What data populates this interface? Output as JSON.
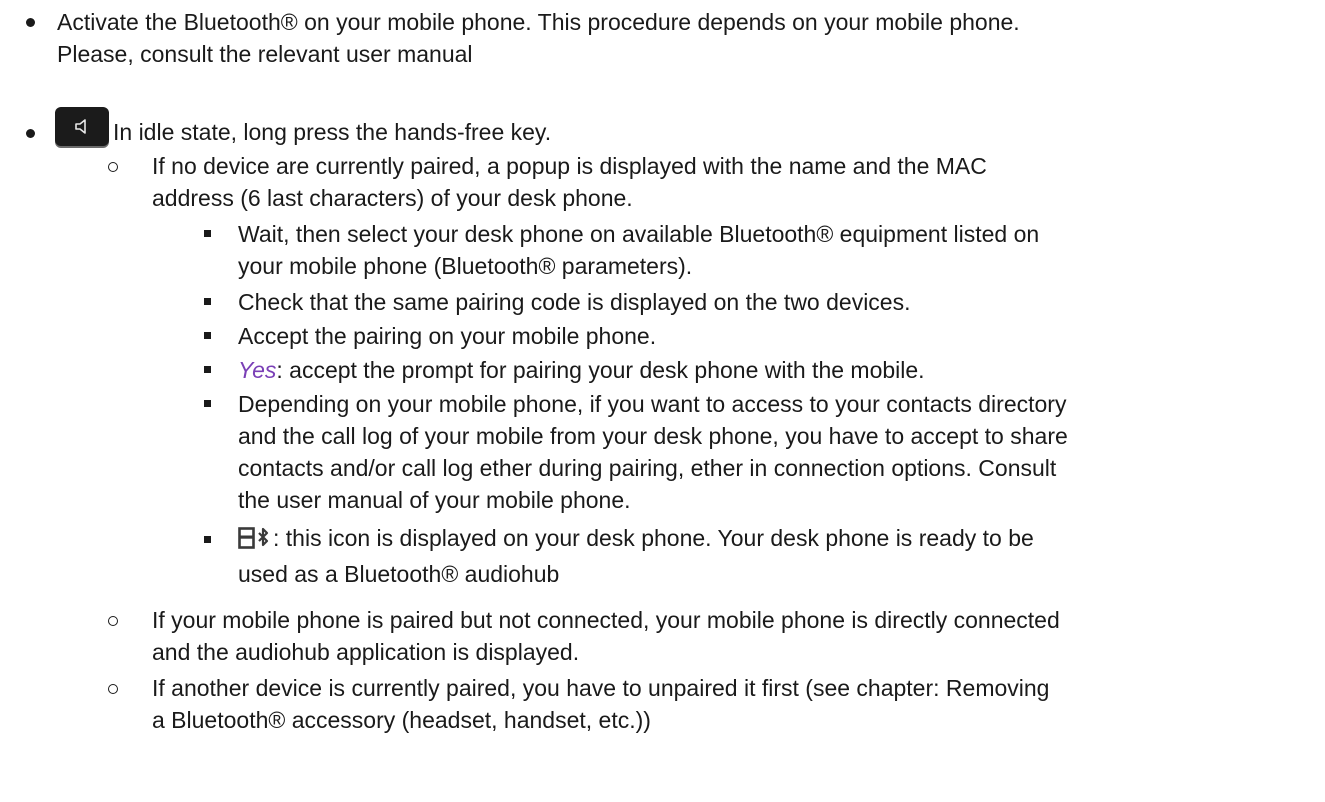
{
  "item1": {
    "line1": "Activate the Bluetooth® on your mobile phone. This procedure depends on your mobile phone.",
    "line2": "Please, consult the relevant user manual"
  },
  "item2": {
    "icon": "hands-free-key-icon",
    "text": "In idle state, long press the hands-free key."
  },
  "sub1": {
    "line1": "If no device are currently paired, a popup is displayed with the name and the MAC",
    "line2": "address (6 last characters) of your desk phone.",
    "steps": {
      "s1_line1": "Wait, then select your desk phone on available Bluetooth® equipment listed on",
      "s1_line2": "your mobile phone (Bluetooth® parameters).",
      "s2": "Check that the same pairing code is displayed on the two devices.",
      "s3": "Accept the pairing on your mobile phone.",
      "s4_key": "Yes",
      "s4_rest": ": accept the prompt for pairing your desk phone with the mobile.",
      "s5_line1": "Depending on your mobile phone, if you want to access to your contacts directory",
      "s5_line2": "and the call log of your mobile from your desk phone, you have to accept to share",
      "s5_line3": "contacts and/or call log ether during pairing, ether in connection options. Consult",
      "s5_line4": "the user manual of your mobile phone.",
      "s6_icon": "bluetooth-audiohub-icon",
      "s6_line1": ": this icon is displayed on your desk phone. Your desk phone is ready to be",
      "s6_line2": "used as a Bluetooth® audiohub"
    }
  },
  "sub2": {
    "line1": "If your mobile phone is paired but not connected, your mobile phone is directly connected",
    "line2": "and the audiohub application is displayed."
  },
  "sub3": {
    "line1": "If another device is currently paired, you have to unpaired it first (see chapter: Removing",
    "line2": "a Bluetooth® accessory (headset, handset, etc.))"
  },
  "colors": {
    "text": "#1a1a1a",
    "emphasis": "#7a3fb6",
    "key": "#1b1b1b"
  }
}
